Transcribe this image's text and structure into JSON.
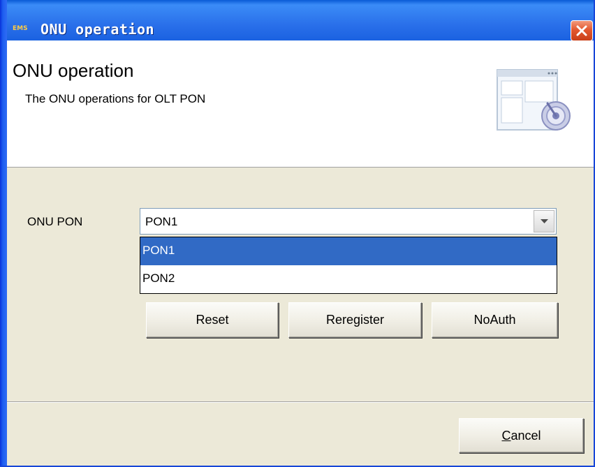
{
  "window": {
    "title": "ONU operation",
    "app_badge": "EMS",
    "close_icon": "close-icon"
  },
  "header": {
    "title": "ONU operation",
    "subtitle": "The ONU operations for OLT PON",
    "icon": "window-config-icon"
  },
  "form": {
    "onu_pon_label": "ONU PON",
    "onu_pon_value": "PON1",
    "options": [
      "PON1",
      "PON2"
    ],
    "selected_option_index": 0
  },
  "actions": {
    "reset_label": "Reset",
    "reregister_label": "Reregister",
    "noauth_label": "NoAuth"
  },
  "footer": {
    "cancel_label": "Cancel",
    "cancel_mnemonic": "C",
    "cancel_rest": "ancel"
  },
  "colors": {
    "titlebar": "#0a5bd6",
    "selection": "#316ac5",
    "dialog_bg": "#ece9d8",
    "close_button": "#e3582f"
  }
}
